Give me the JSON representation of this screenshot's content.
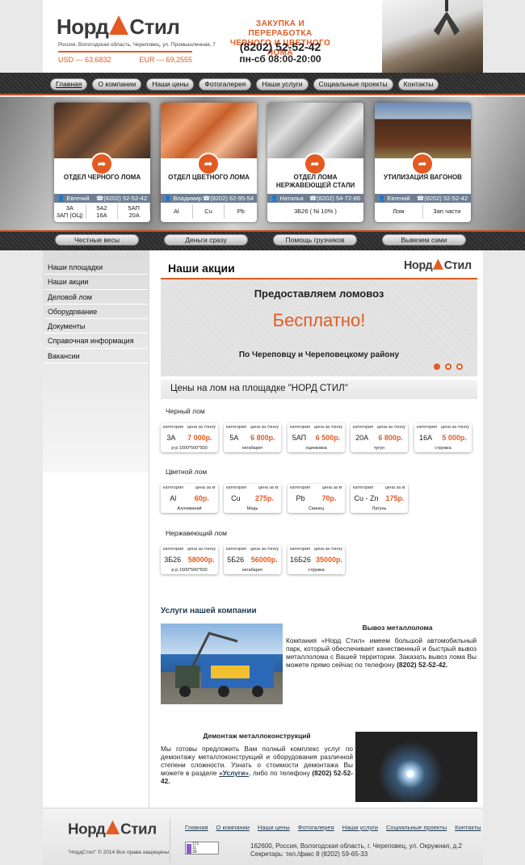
{
  "header": {
    "logo_left": "Норд",
    "logo_right": "Стил",
    "address": "Россия, Вологодская область, Череповец, ул. Промышленная, 7",
    "usd": "USD — 63,6832",
    "eur": "EUR — 69,2555",
    "slogan_line1": "ЗАКУПКА И ПЕРЕРАБОТКА",
    "slogan_line2": "ЧЕРНОГО И ЦВЕТНОГО ЛОМА",
    "phone": "(8202) 52-52-42",
    "hours": "пн-сб 08:00-20:00"
  },
  "nav": [
    "Главная",
    "О компании",
    "Наши цены",
    "Фотогалерея",
    "Наши услуги",
    "Социальные проекты",
    "Контакты"
  ],
  "cards": [
    {
      "title": "ОТДЕЛ ЧЕРНОГО ЛОМА",
      "person": "Евгений",
      "phone": "(8202) 52-52-42",
      "meta": [
        "3А",
        "5А2",
        "5АП",
        "3АП (ОЦ)",
        "16А",
        "20А"
      ],
      "cols": 3
    },
    {
      "title": "ОТДЕЛ ЦВЕТНОГО ЛОМА",
      "person": "Владимир",
      "phone": "(8202) 62-95-54",
      "meta": [
        "Al",
        "Cu",
        "Pb"
      ],
      "cols": 3
    },
    {
      "title": "ОТДЕЛ ЛОМА НЕРЖАВЕЮЩЕЙ СТАЛИ",
      "person": "Наталья",
      "phone": "(8202) 54-72-86",
      "meta": [
        "3Б26 ( Ni 10% )"
      ],
      "cols": 1
    },
    {
      "title": "УТИЛИЗАЦИЯ ВАГОНОВ",
      "person": "Евгений",
      "phone": "(8202) 52-52-42",
      "meta": [
        "Лом",
        "Зап.части"
      ],
      "cols": 2
    }
  ],
  "bar2": [
    "Честные весы",
    "Деньги сразу",
    "Помощь грузчиков",
    "Вывезем сами"
  ],
  "sidebar": [
    "Наши площадки",
    "Наши акции",
    "Деловой лом",
    "Оборудование",
    "Документы",
    "Справочная информация",
    "Вакансии"
  ],
  "main": {
    "title": "Наши акции",
    "slide_line1": "Предоставляем ломовоз",
    "slide_line2": "Бесплатно!",
    "slide_line3": "По Череповцу и Череповецкому району",
    "price_heading": "Цены на лом на площадке \"НОРД СТИЛ\""
  },
  "prices": {
    "black": {
      "label": "Черный лом",
      "head_cat": "категория",
      "head_price": "цена за тонну",
      "items": [
        {
          "cat": "3А",
          "price": "7 000р.",
          "note": "р-р 1500*500*500"
        },
        {
          "cat": "5А",
          "price": "6 800р.",
          "note": "негабарит"
        },
        {
          "cat": "5АП",
          "price": "6 500р.",
          "note": "оцинковка"
        },
        {
          "cat": "20А",
          "price": "6 800р.",
          "note": "чугун"
        },
        {
          "cat": "16А",
          "price": "5 000р.",
          "note": "стружка"
        }
      ]
    },
    "color": {
      "label": "Цветной лом",
      "head_cat": "категория",
      "head_price": "цена за кг",
      "items": [
        {
          "cat": "Al",
          "price": "60р.",
          "note": "Аллюминий"
        },
        {
          "cat": "Cu",
          "price": "275р.",
          "note": "Медь"
        },
        {
          "cat": "Pb",
          "price": "70р.",
          "note": "Свинец"
        },
        {
          "cat": "Cu - Zn",
          "price": "175р.",
          "note": "Латунь"
        }
      ]
    },
    "stainless": {
      "label": "Нержавеющий лом",
      "head_cat": "категория",
      "head_price": "цена за тонну",
      "items": [
        {
          "cat": "3Б26",
          "price": "58000р.",
          "note": "р-р 1500*500*500"
        },
        {
          "cat": "5Б26",
          "price": "56000р.",
          "note": "негабарит"
        },
        {
          "cat": "16Б26",
          "price": "35000р.",
          "note": "стружка"
        }
      ]
    }
  },
  "services": {
    "heading": "Услуги нашей компании",
    "removal_title": "Вывоз металлолома",
    "removal_text": "Компания «Норд Стил» имеем большой автомобильный парк, который обеспечивает качественный и быстрый вывоз металлолома с Вашей территории. Заказать вывоз лома Вы можете прямо сейчас по телефону",
    "removal_phone": "(8202) 52-52-42.",
    "dismantle_title": "Демонтаж металлоконструкций",
    "dismantle_text": "Мы готовы предложить Вам полный комплекс услуг по демонтажу металлоконструкций и оборудования различной степени сложности. Узнать о стоимости демонтажа Вы можете в разделе",
    "dismantle_link": "«Услуги»",
    "dismantle_tail": ", либо по телефону",
    "dismantle_phone": "(8202) 52-52-42."
  },
  "footer": {
    "copyright": "\"НордСтил\" © 2014 Все права защищены",
    "links": [
      "Главная",
      "О компании",
      "Наши цены",
      "Фотогалерея",
      "Наши услуги",
      "Социальные проекты",
      "Контакты"
    ],
    "counter": [
      "171",
      "11",
      "39"
    ],
    "address": "162600, Россия, Вологодская область, г. Череповец, ул. Окружная, д.2",
    "contact": "Секретарь: тел./факс 8 (8202) 59-65-33"
  },
  "colors": {
    "accent": "#e35b22",
    "dark": "#2a2a2a",
    "contact_bar": "#6e7f92"
  }
}
